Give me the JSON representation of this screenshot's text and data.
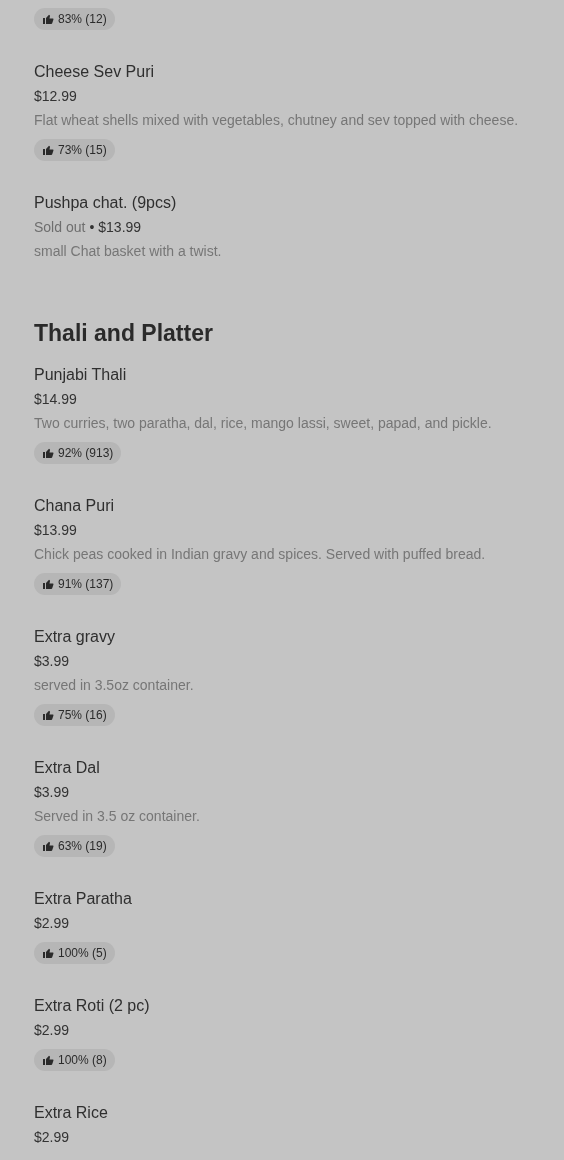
{
  "sections": [
    {
      "items": [
        {
          "rating": "83% (12)"
        },
        {
          "name": "Cheese Sev Puri",
          "price": "$12.99",
          "description": "Flat wheat shells mixed with vegetables, chutney and sev topped with cheese.",
          "rating": "73% (15)"
        },
        {
          "name": "Pushpa chat. (9pcs)",
          "status": "Sold out",
          "separator": "•",
          "price": "$13.99",
          "description": "small Chat basket with a twist."
        }
      ]
    },
    {
      "title": "Thali and Platter",
      "items": [
        {
          "name": "Punjabi Thali",
          "price": "$14.99",
          "description": "Two curries, two paratha, dal, rice, mango lassi, sweet, papad, and pickle.",
          "rating": "92% (913)"
        },
        {
          "name": "Chana Puri",
          "price": "$13.99",
          "description": "Chick peas cooked in Indian gravy and spices. Served with puffed bread.",
          "rating": "91% (137)"
        },
        {
          "name": "Extra gravy",
          "price": "$3.99",
          "description": "served in 3.5oz container.",
          "rating": "75% (16)"
        },
        {
          "name": "Extra Dal",
          "price": "$3.99",
          "description": "Served in 3.5 oz container.",
          "rating": "63% (19)"
        },
        {
          "name": "Extra Paratha",
          "price": "$2.99",
          "rating": "100% (5)"
        },
        {
          "name": "Extra Roti (2 pc)",
          "price": "$2.99",
          "rating": "100% (8)"
        },
        {
          "name": "Extra Rice",
          "price": "$2.99"
        }
      ]
    }
  ]
}
